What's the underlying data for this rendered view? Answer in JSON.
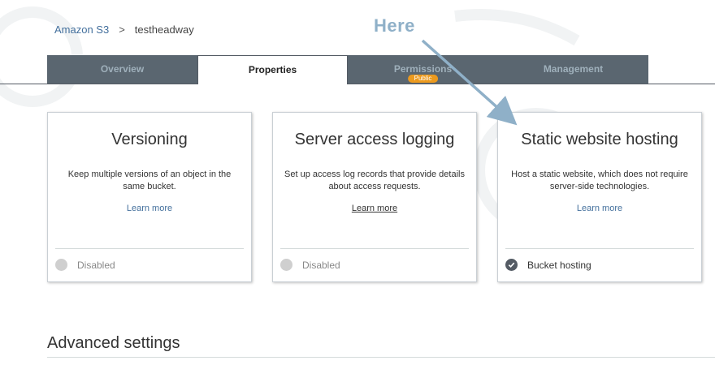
{
  "breadcrumb": {
    "root": "Amazon S3",
    "separator": ">",
    "current": "testheadway"
  },
  "tabs": [
    {
      "label": "Overview",
      "active": false
    },
    {
      "label": "Properties",
      "active": true
    },
    {
      "label": "Permissions",
      "active": false,
      "badge": "Public"
    },
    {
      "label": "Management",
      "active": false
    }
  ],
  "annotation": {
    "text": "Here",
    "color": "#8fb0c8"
  },
  "cards": [
    {
      "title": "Versioning",
      "description": "Keep multiple versions of an object in the same bucket.",
      "link": "Learn more",
      "status": "Disabled",
      "status_icon": "disabled-dot-icon"
    },
    {
      "title": "Server access logging",
      "description": "Set up access log records that provide details about access requests.",
      "link": "Learn more",
      "status": "Disabled",
      "status_icon": "disabled-dot-icon"
    },
    {
      "title": "Static website hosting",
      "description": "Host a static website, which does not require server-side technologies.",
      "link": "Learn more",
      "status": "Bucket hosting",
      "status_icon": "check-circle-icon"
    }
  ],
  "advanced": {
    "title": "Advanced settings"
  },
  "colors": {
    "tab_bg": "#5a6670",
    "badge": "#ec9a1e",
    "link": "#44709d"
  }
}
